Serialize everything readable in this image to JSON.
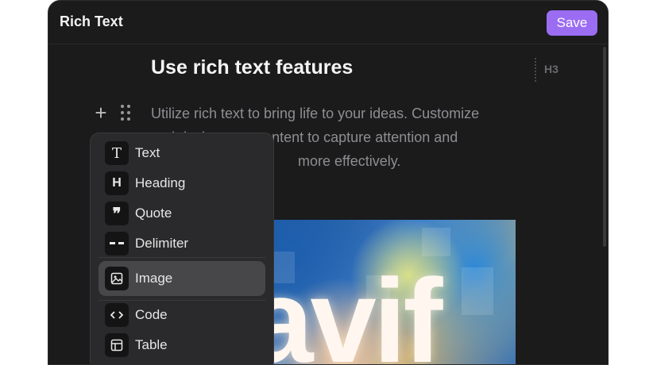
{
  "window": {
    "title": "Rich Text",
    "save_label": "Save"
  },
  "document": {
    "title": "Use rich text features",
    "heading_level": "H3",
    "paragraph_lines": [
      "Utilize rich text to bring life to your ideas. Customize",
      "and design your content to capture attention and",
      "more effectively."
    ],
    "image_text": "avif"
  },
  "menu": {
    "items": [
      {
        "label": "Text",
        "icon": "text-icon",
        "glyph": "T"
      },
      {
        "label": "Heading",
        "icon": "heading-icon",
        "glyph": "H"
      },
      {
        "label": "Quote",
        "icon": "quote-icon",
        "glyph": "❞"
      },
      {
        "label": "Delimiter",
        "icon": "delimiter-icon",
        "glyph": "-- "
      },
      {
        "label": "Image",
        "icon": "image-icon",
        "glyph": ""
      },
      {
        "label": "Code",
        "icon": "code-icon",
        "glyph": "<>"
      },
      {
        "label": "Table",
        "icon": "table-icon",
        "glyph": ""
      }
    ],
    "active_item": "Image"
  },
  "colors": {
    "accent": "#9b6df2",
    "background": "#1b1b1c",
    "menu_bg": "#2a2a2c"
  }
}
